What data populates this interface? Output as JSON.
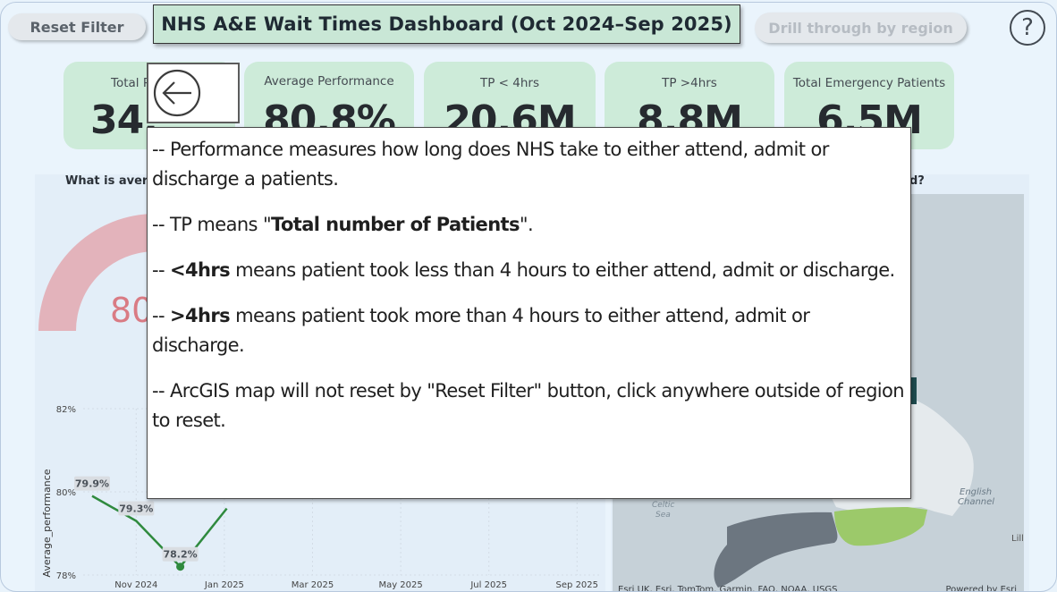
{
  "header": {
    "reset_label": "Reset Filter",
    "title": "NHS A&E Wait Times Dashboard (Oct 2024–Sep 2025)",
    "drill_label": "Drill through by region",
    "help_icon": "?"
  },
  "kpis": [
    {
      "label": "Total P",
      "value": "34."
    },
    {
      "label": "Average Performance",
      "value": "80.8%"
    },
    {
      "label": "TP < 4hrs",
      "value": "20.6M"
    },
    {
      "label": "TP >4hrs",
      "value": "8.8M"
    },
    {
      "label": "Total Emergency Patients",
      "value": "6.5M"
    }
  ],
  "left_visual": {
    "question": "What is avera",
    "gauge_value": "80",
    "chart_data": {
      "type": "line",
      "ylabel": "Average_performance",
      "y_ticks": [
        "82%",
        "80%",
        "78%"
      ],
      "x_ticks": [
        "Nov 2024",
        "Jan 2025",
        "Mar 2025",
        "May 2025",
        "Jul 2025",
        "Sep 2025"
      ],
      "ylim": [
        78,
        82
      ],
      "points": [
        {
          "x": "Oct 2024",
          "y": 79.9,
          "label": "79.9%"
        },
        {
          "x": "Nov 2024",
          "y": 79.3,
          "label": "79.3%"
        },
        {
          "x": "Dec 2024",
          "y": 78.2,
          "label": "78.2%"
        }
      ],
      "color": "#2f8a3e"
    }
  },
  "right_visual": {
    "question_tail": "d?",
    "map_labels": [
      "English Channel",
      "Celtic Sea"
    ],
    "attribution": "Esri UK, Esri, TomTom, Garmin, FAO, NOAA, USGS",
    "powered_by": "Powered by Esri",
    "map_corner_text": "Lill"
  },
  "info_popup": {
    "p1": "-- Performance measures how long does NHS take to either   attend, admit or discharge a patients.",
    "p2_prefix": "-- TP means \"",
    "p2_bold": "Total number of Patients",
    "p2_suffix": "\".",
    "p3_prefix": "-- ",
    "p3_bold": "<4hrs",
    "p3_suffix": " means patient took less than 4 hours to either attend, admit or discharge.",
    "p4_prefix": "-- ",
    "p4_bold": ">4hrs",
    "p4_suffix": " means patient took more than 4 hours to either attend, admit or discharge.",
    "p5": "-- ArcGIS map will not reset by \"Reset Filter\" button, click anywhere outside of region to reset."
  },
  "colors": {
    "kpi_bg": "#cdebd9",
    "title_bg": "#c9e7d6",
    "gauge": "#e3b3bb",
    "line": "#2f8a3e",
    "map_highlight": "#9cc96a"
  }
}
